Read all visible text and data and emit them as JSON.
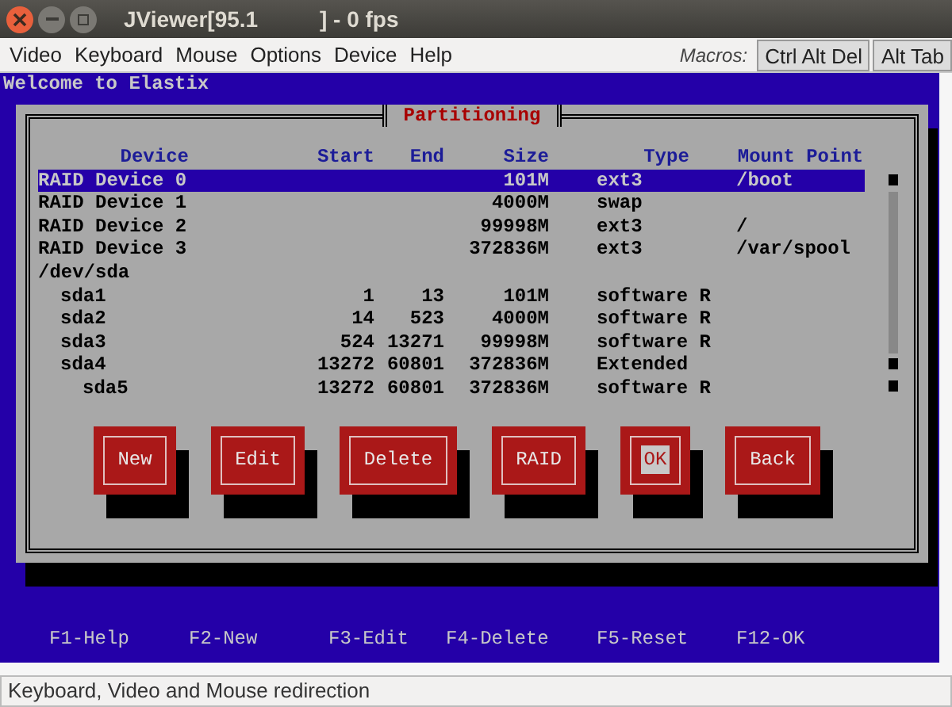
{
  "window": {
    "title": "JViewer[95.1          ] - 0 fps"
  },
  "menu": [
    {
      "label": "Video"
    },
    {
      "label": "Keyboard"
    },
    {
      "label": "Mouse"
    },
    {
      "label": "Options"
    },
    {
      "label": "Device"
    },
    {
      "label": "Help"
    }
  ],
  "macros": {
    "label": "Macros:",
    "buttons": [
      "Ctrl Alt Del",
      "Alt Tab"
    ]
  },
  "console": {
    "banner": "Welcome to Elastix",
    "dialog": {
      "title": "Partitioning",
      "columns": [
        "Device",
        "Start",
        "End",
        "Size",
        "Type",
        "Mount Point"
      ],
      "rows": [
        {
          "device": "RAID Device 0",
          "size": "101M",
          "type": "ext3",
          "mount": "/boot",
          "selected": true
        },
        {
          "device": "RAID Device 1",
          "size": "4000M",
          "type": "swap",
          "selected": false
        },
        {
          "device": "RAID Device 2",
          "size": "99998M",
          "type": "ext3",
          "mount": "/",
          "selected": false
        },
        {
          "device": "RAID Device 3",
          "size": "372836M",
          "type": "ext3",
          "mount": "/var/spool",
          "selected": false
        },
        {
          "device": "/dev/sda",
          "selected": false,
          "children": [
            {
              "device": "sda1",
              "start": "1",
              "end": "13",
              "size": "101M",
              "type": "software R",
              "selected": false
            },
            {
              "device": "sda2",
              "start": "14",
              "end": "523",
              "size": "4000M",
              "type": "software R",
              "selected": false
            },
            {
              "device": "sda3",
              "start": "524",
              "end": "13271",
              "size": "99998M",
              "type": "software R",
              "selected": false
            },
            {
              "device": "sda4",
              "start": "13272",
              "end": "60801",
              "size": "372836M",
              "type": "Extended",
              "selected": false,
              "children": [
                {
                  "device": "sda5",
                  "start": "13272",
                  "end": "60801",
                  "size": "372836M",
                  "type": "software R",
                  "selected": false
                }
              ]
            }
          ]
        }
      ],
      "buttons": [
        {
          "label": "New",
          "selected": false
        },
        {
          "label": "Edit",
          "selected": false
        },
        {
          "label": "Delete",
          "selected": false
        },
        {
          "label": "RAID",
          "selected": false
        },
        {
          "label": "OK",
          "selected": true
        },
        {
          "label": "Back",
          "selected": false
        }
      ]
    },
    "hotkeys": [
      "F1-Help",
      "F2-New",
      "F3-Edit",
      "F4-Delete",
      "F5-Reset",
      "F12-OK"
    ]
  },
  "status_bar": "Keyboard, Video and Mouse redirection"
}
